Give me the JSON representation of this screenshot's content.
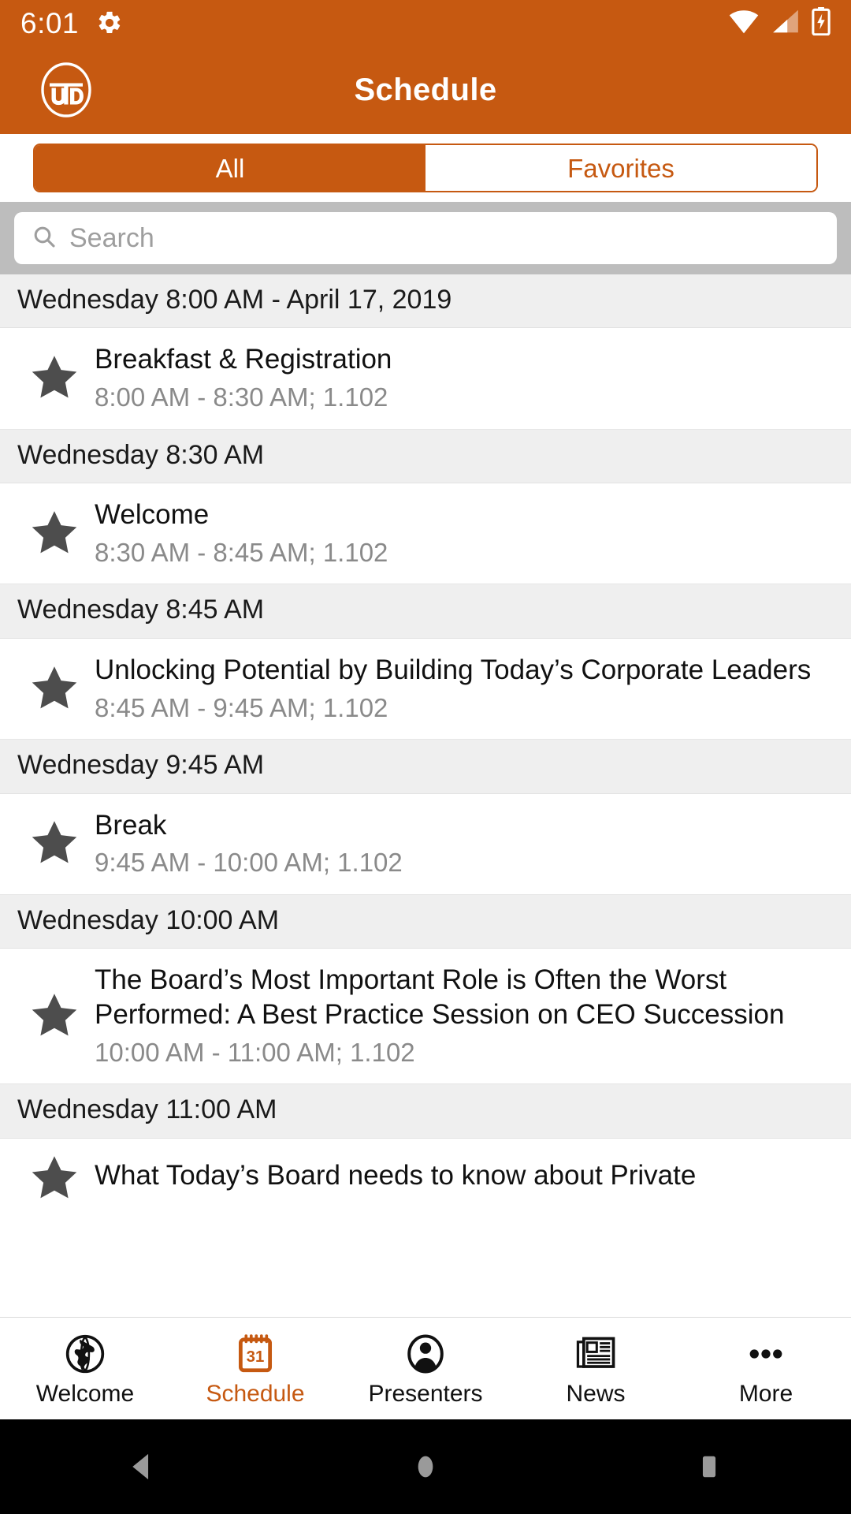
{
  "status_bar": {
    "time": "6:01",
    "icons": [
      "gear-icon",
      "wifi-icon",
      "cell-signal-icon",
      "battery-charging-icon"
    ]
  },
  "app_bar": {
    "title": "Schedule",
    "logo_text": "UTD",
    "background_color": "#C65911"
  },
  "segmented_control": {
    "options": [
      {
        "label": "All",
        "selected": true
      },
      {
        "label": "Favorites",
        "selected": false
      }
    ]
  },
  "search": {
    "value": "",
    "placeholder": "Search",
    "icon": "search-icon"
  },
  "schedule": {
    "groups": [
      {
        "header": "Wednesday 8:00 AM - April 17, 2019",
        "sessions": [
          {
            "title": "Breakfast & Registration",
            "details": "8:00 AM - 8:30 AM; 1.102",
            "favorite": true
          }
        ]
      },
      {
        "header": "Wednesday 8:30 AM",
        "sessions": [
          {
            "title": "Welcome",
            "details": "8:30 AM - 8:45 AM; 1.102",
            "favorite": true
          }
        ]
      },
      {
        "header": "Wednesday 8:45 AM",
        "sessions": [
          {
            "title": "Unlocking Potential by Building Today’s Corporate Leaders",
            "details": "8:45 AM - 9:45 AM; 1.102",
            "favorite": true
          }
        ]
      },
      {
        "header": "Wednesday 9:45 AM",
        "sessions": [
          {
            "title": "Break",
            "details": "9:45 AM - 10:00 AM; 1.102",
            "favorite": true
          }
        ]
      },
      {
        "header": "Wednesday 10:00 AM",
        "sessions": [
          {
            "title": "The Board’s Most Important Role is Often the Worst Performed: A Best Practice Session on CEO Succession",
            "details": "10:00 AM - 11:00 AM; 1.102",
            "favorite": true
          }
        ]
      },
      {
        "header": "Wednesday 11:00 AM",
        "sessions": [
          {
            "title": "What Today’s Board needs to know about Private",
            "details": "",
            "favorite": true
          }
        ]
      }
    ]
  },
  "tab_bar": {
    "items": [
      {
        "label": "Welcome",
        "icon": "globe-icon",
        "active": false
      },
      {
        "label": "Schedule",
        "icon": "calendar-icon",
        "active": true,
        "calendar_day": "31"
      },
      {
        "label": "Presenters",
        "icon": "person-icon",
        "active": false
      },
      {
        "label": "News",
        "icon": "newspaper-icon",
        "active": false
      },
      {
        "label": "More",
        "icon": "ellipsis-icon",
        "active": false
      }
    ],
    "accent_color": "#C65911"
  },
  "android_nav": {
    "buttons": [
      "back-icon",
      "home-icon",
      "recents-icon"
    ]
  }
}
